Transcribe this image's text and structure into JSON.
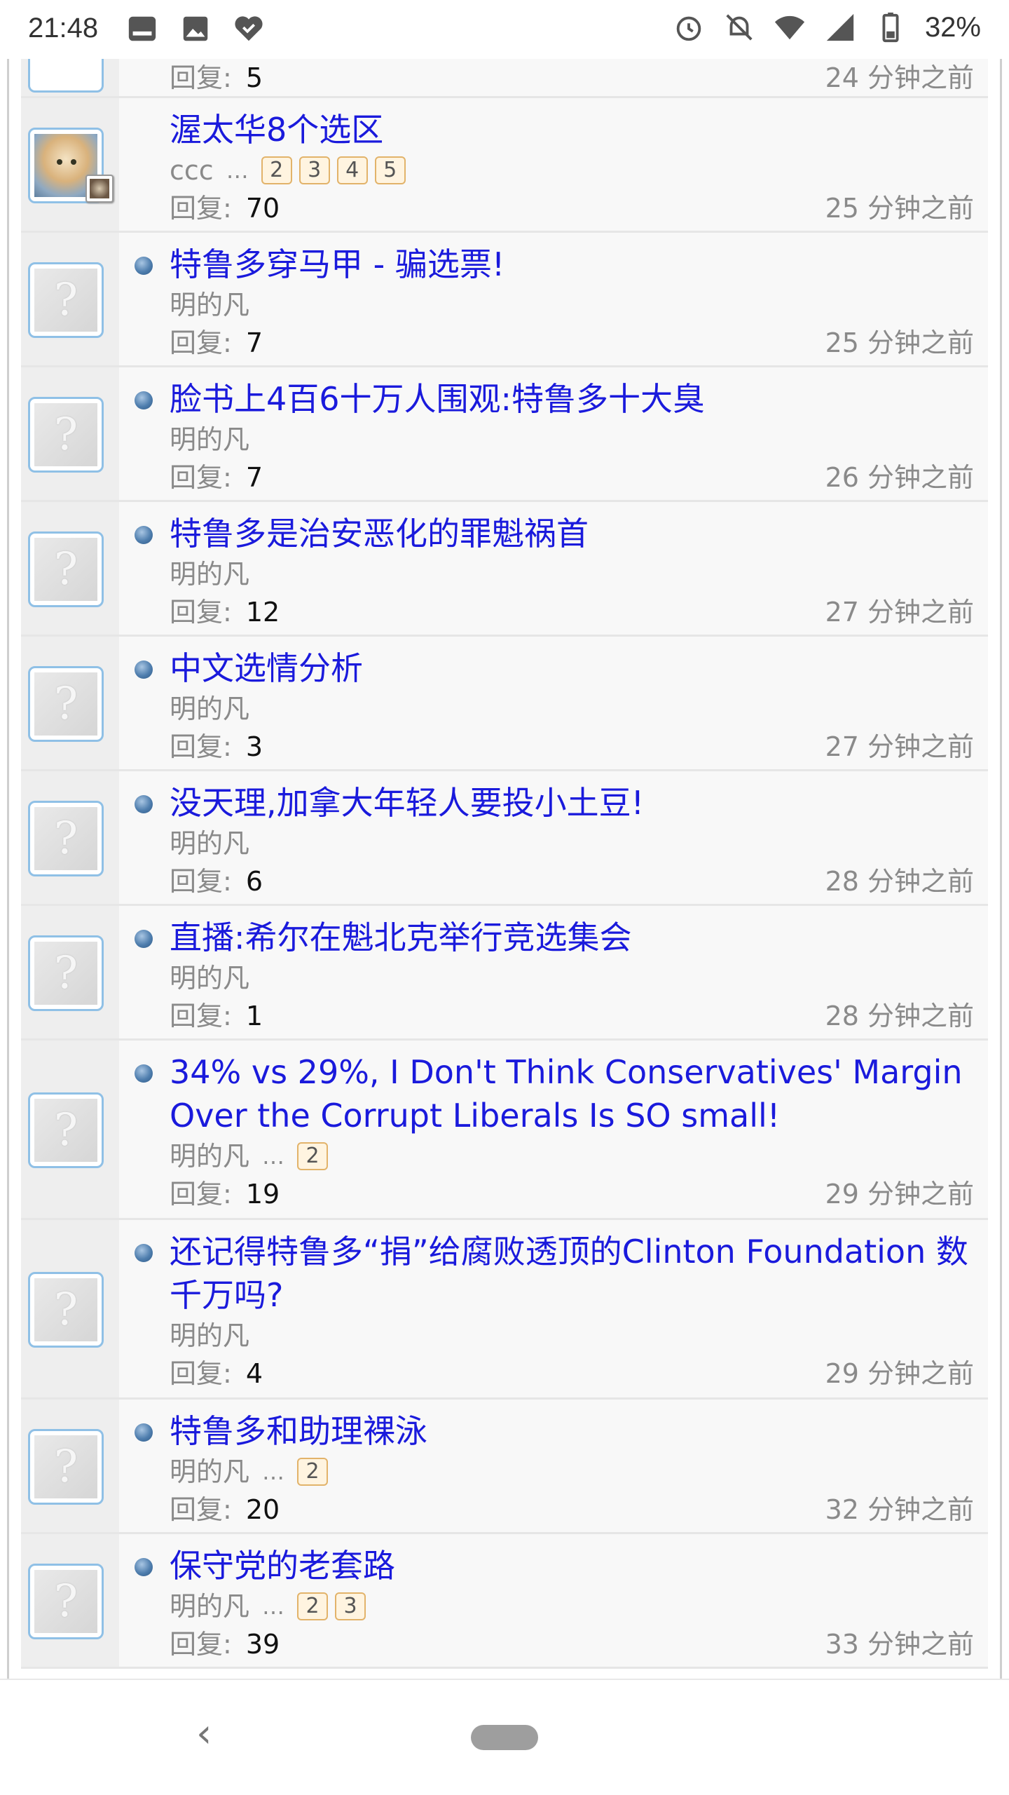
{
  "status_bar": {
    "time": "21:48",
    "battery": "32%",
    "left_icons": [
      "notification-app-icon",
      "image-icon",
      "heart-app-icon"
    ],
    "right_icons": [
      "alarm-icon",
      "bell-off-icon",
      "wifi-icon",
      "signal-icon",
      "battery-icon"
    ]
  },
  "topics": [
    {
      "title": "",
      "author": "",
      "pages": [],
      "reply_label": "回复:",
      "replies": "5",
      "time": "24 分钟之前",
      "avatar": "question",
      "partial": true
    },
    {
      "title": "渥太华8个选区",
      "author": "ccc",
      "pages": [
        "2",
        "3",
        "4",
        "5"
      ],
      "reply_label": "回复:",
      "replies": "70",
      "time": "25 分钟之前",
      "avatar": "photo"
    },
    {
      "title": "特鲁多穿马甲 - 骗选票!",
      "author": "明的凡",
      "pages": [],
      "reply_label": "回复:",
      "replies": "7",
      "time": "25 分钟之前",
      "avatar": "question"
    },
    {
      "title": "脸书上4百6十万人围观:特鲁多十大臭",
      "author": "明的凡",
      "pages": [],
      "reply_label": "回复:",
      "replies": "7",
      "time": "26 分钟之前",
      "avatar": "question"
    },
    {
      "title": "特鲁多是治安恶化的罪魁祸首",
      "author": "明的凡",
      "pages": [],
      "reply_label": "回复:",
      "replies": "12",
      "time": "27 分钟之前",
      "avatar": "question"
    },
    {
      "title": "中文选情分析",
      "author": "明的凡",
      "pages": [],
      "reply_label": "回复:",
      "replies": "3",
      "time": "27 分钟之前",
      "avatar": "question"
    },
    {
      "title": "没天理,加拿大年轻人要投小土豆!",
      "author": "明的凡",
      "pages": [],
      "reply_label": "回复:",
      "replies": "6",
      "time": "28 分钟之前",
      "avatar": "question"
    },
    {
      "title": "直播:希尔在魁北克举行竞选集会",
      "author": "明的凡",
      "pages": [],
      "reply_label": "回复:",
      "replies": "1",
      "time": "28 分钟之前",
      "avatar": "question"
    },
    {
      "title": "34% vs 29%, I Don't Think Conservatives' Margin Over the Corrupt Liberals Is SO small!",
      "author": "明的凡",
      "pages": [
        "2"
      ],
      "reply_label": "回复:",
      "replies": "19",
      "time": "29 分钟之前",
      "avatar": "question"
    },
    {
      "title": "还记得特鲁多“捐”给腐败透顶的Clinton Foundation 数千万吗?",
      "author": "明的凡",
      "pages": [],
      "reply_label": "回复:",
      "replies": "4",
      "time": "29 分钟之前",
      "avatar": "question"
    },
    {
      "title": "特鲁多和助理裸泳",
      "author": "明的凡",
      "pages": [
        "2"
      ],
      "reply_label": "回复:",
      "replies": "20",
      "time": "32 分钟之前",
      "avatar": "question"
    },
    {
      "title": "保守党的老套路",
      "author": "明的凡",
      "pages": [
        "2",
        "3"
      ],
      "reply_label": "回复:",
      "replies": "39",
      "time": "33 分钟之前",
      "avatar": "question"
    }
  ],
  "nav": {
    "back_glyph": "‹"
  }
}
